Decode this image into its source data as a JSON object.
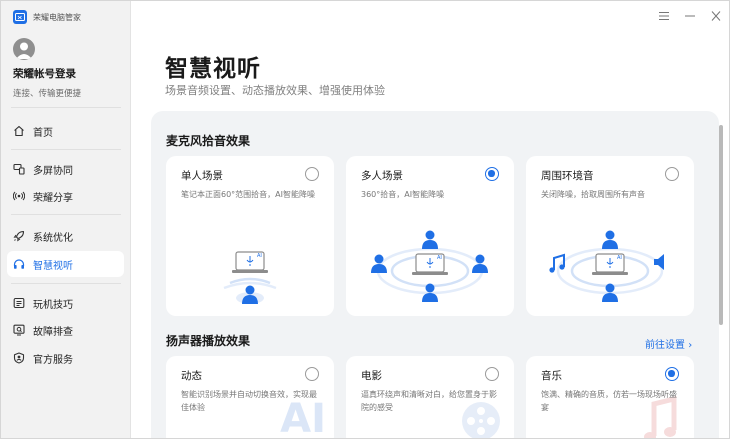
{
  "app": {
    "title": "荣耀电脑管家"
  },
  "account": {
    "name": "荣耀帐号登录",
    "subtitle": "连接、传输更便捷"
  },
  "nav": {
    "items": [
      {
        "label": "首页",
        "icon": "home-icon"
      },
      {
        "label": "多屏协同",
        "icon": "multiscreen-icon"
      },
      {
        "label": "荣耀分享",
        "icon": "share-icon"
      },
      {
        "label": "系统优化",
        "icon": "rocket-icon"
      },
      {
        "label": "智慧视听",
        "icon": "headphones-icon",
        "active": true
      },
      {
        "label": "玩机技巧",
        "icon": "tips-icon"
      },
      {
        "label": "故障排查",
        "icon": "troubleshoot-icon"
      },
      {
        "label": "官方服务",
        "icon": "service-icon"
      }
    ]
  },
  "window": {
    "buttons": [
      "menu-icon",
      "minimize-icon",
      "close-icon"
    ]
  },
  "page": {
    "title": "智慧视听",
    "subtitle": "场景音频设置、动态播放效果、增强使用体验"
  },
  "mic": {
    "title": "麦克风拾音效果",
    "cards": [
      {
        "title": "单人场景",
        "desc": "笔记本正面60°范围拾音，AI智能降噪",
        "selected": false
      },
      {
        "title": "多人场景",
        "desc": "360°拾音，AI智能降噪",
        "selected": true
      },
      {
        "title": "周围环境音",
        "desc": "关闭降噪，拾取周围所有声音",
        "selected": false
      }
    ]
  },
  "speaker": {
    "title": "扬声器播放效果",
    "link": "前往设置",
    "cards": [
      {
        "title": "动态",
        "desc": "智能识别场景并自动切换音效，实现最佳体验",
        "selected": false,
        "watermark": "AI"
      },
      {
        "title": "电影",
        "desc": "逼真环绕声和清晰对白，给您置身于影院的感受",
        "selected": false
      },
      {
        "title": "音乐",
        "desc": "饱满、精确的音质，仿若一场现场听盛宴",
        "selected": true
      }
    ]
  },
  "colors": {
    "accent": "#1f6fe5",
    "sidebar_bg": "#f2f2f2",
    "content_bg": "#f1f3f5"
  }
}
